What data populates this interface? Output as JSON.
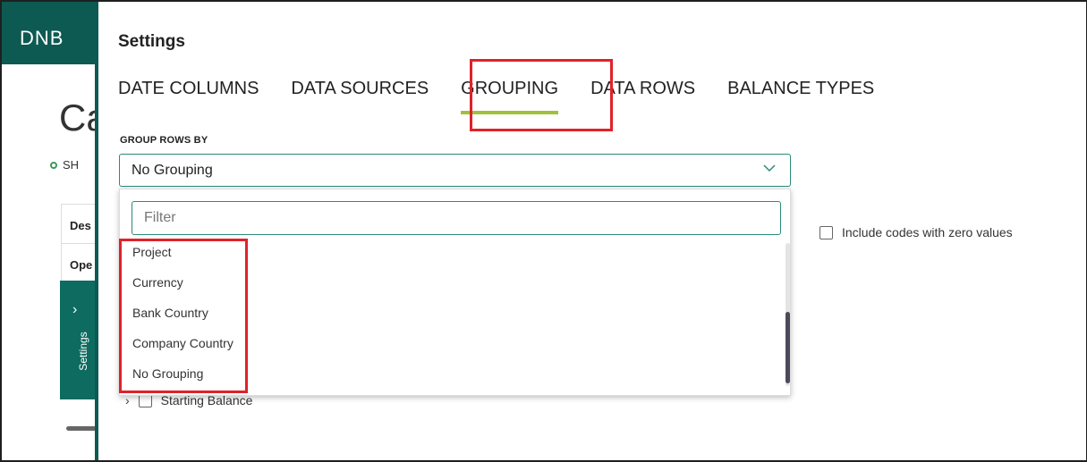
{
  "background": {
    "logo": "DNB",
    "title_fragment": "Ca",
    "status_fragment": "SH",
    "col_header_1": "Des",
    "col_header_2": "Ope",
    "settings_tab_label": "Settings"
  },
  "panel": {
    "title": "Settings",
    "tabs": [
      {
        "label": "DATE COLUMNS",
        "active": false
      },
      {
        "label": "DATA SOURCES",
        "active": false
      },
      {
        "label": "GROUPING",
        "active": true
      },
      {
        "label": "DATA ROWS",
        "active": false
      },
      {
        "label": "BALANCE TYPES",
        "active": false
      }
    ],
    "group_rows_label": "GROUP ROWS BY",
    "selected_grouping": "No Grouping",
    "include_zero_label": "Include codes with zero values",
    "starting_balance_label": "Starting Balance"
  },
  "dropdown": {
    "filter_placeholder": "Filter",
    "options": [
      "Project",
      "Currency",
      "Bank Country",
      "Company Country",
      "No Grouping"
    ]
  },
  "colors": {
    "brand": "#0d5a52",
    "accent_underline": "#a0c23a",
    "highlight": "#e0222a",
    "input_border": "#2a8a7a"
  }
}
